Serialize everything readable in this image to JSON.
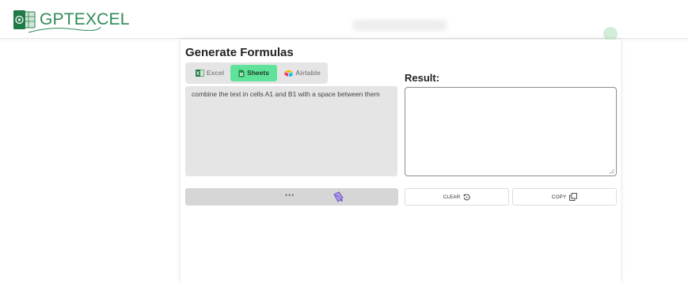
{
  "brand": {
    "name": "GPTEXCEL"
  },
  "panel": {
    "title": "Generate Formulas",
    "tabs": [
      {
        "label": "Excel",
        "icon": "excel-icon",
        "active": false
      },
      {
        "label": "Sheets",
        "icon": "sheets-icon",
        "active": true
      },
      {
        "label": "Airtable",
        "icon": "airtable-icon",
        "active": false
      }
    ],
    "prompt_text": "combine the text in cells A1 and B1 with a space between them",
    "generate_loading": "•••",
    "result_label": "Result:",
    "result_value": "",
    "clear_label": "CLEAR",
    "copy_label": "COPY"
  },
  "colors": {
    "brand_green": "#2e8b57",
    "active_tab": "#5fe39a",
    "input_bg": "#e5e5e5"
  }
}
